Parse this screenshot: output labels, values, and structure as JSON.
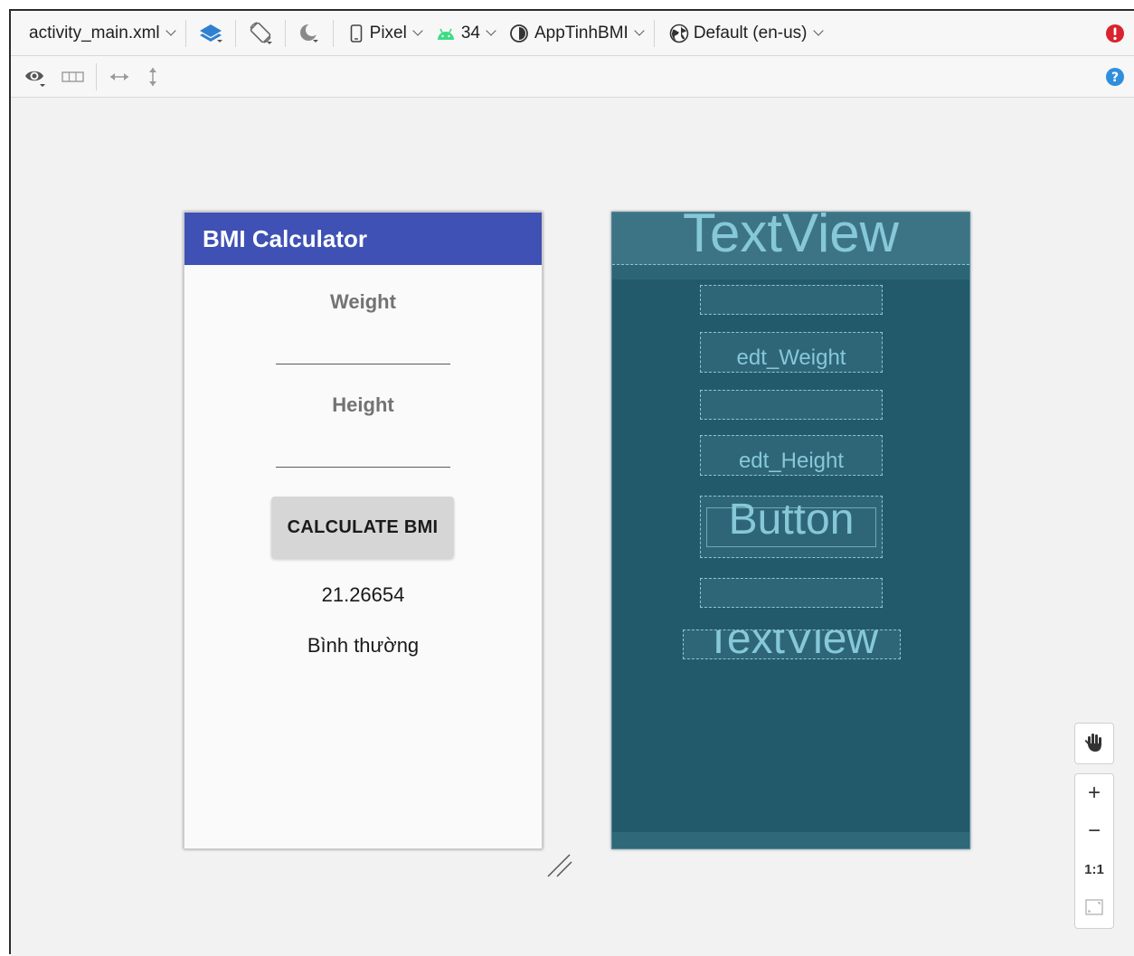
{
  "toolbar": {
    "file_name": "activity_main.xml",
    "device": "Pixel",
    "api_level": "34",
    "theme": "AppTinhBMI",
    "locale": "Default (en-us)",
    "icons": [
      "layers-icon",
      "rotate-icon",
      "night-mode-icon",
      "phone-icon",
      "android-icon",
      "theme-icon",
      "globe-icon",
      "error-icon"
    ]
  },
  "toolbar2": {
    "icons": [
      "eye-icon",
      "layout-grid-icon",
      "horizontal-resize-icon",
      "vertical-resize-icon",
      "help-icon"
    ]
  },
  "design": {
    "app_title": "BMI Calculator",
    "weight_label": "Weight",
    "height_label": "Height",
    "button_label": "CALCULATE BMI",
    "bmi_value": "21.26654",
    "bmi_status": "Bình thường"
  },
  "blueprint": {
    "title_placeholder": "TextView",
    "weight_field": "edt_Weight",
    "height_field": "edt_Height",
    "button_placeholder": "Button",
    "result_placeholder": "TextView"
  },
  "zoom": {
    "zoom_in": "+",
    "zoom_out": "−",
    "actual_size": "1:1"
  },
  "colors": {
    "app_bar": "#3f51b5",
    "blueprint_bg": "#235a6b",
    "blueprint_text": "#86c8d8",
    "error": "#d9232e",
    "help": "#2f8fdd"
  }
}
